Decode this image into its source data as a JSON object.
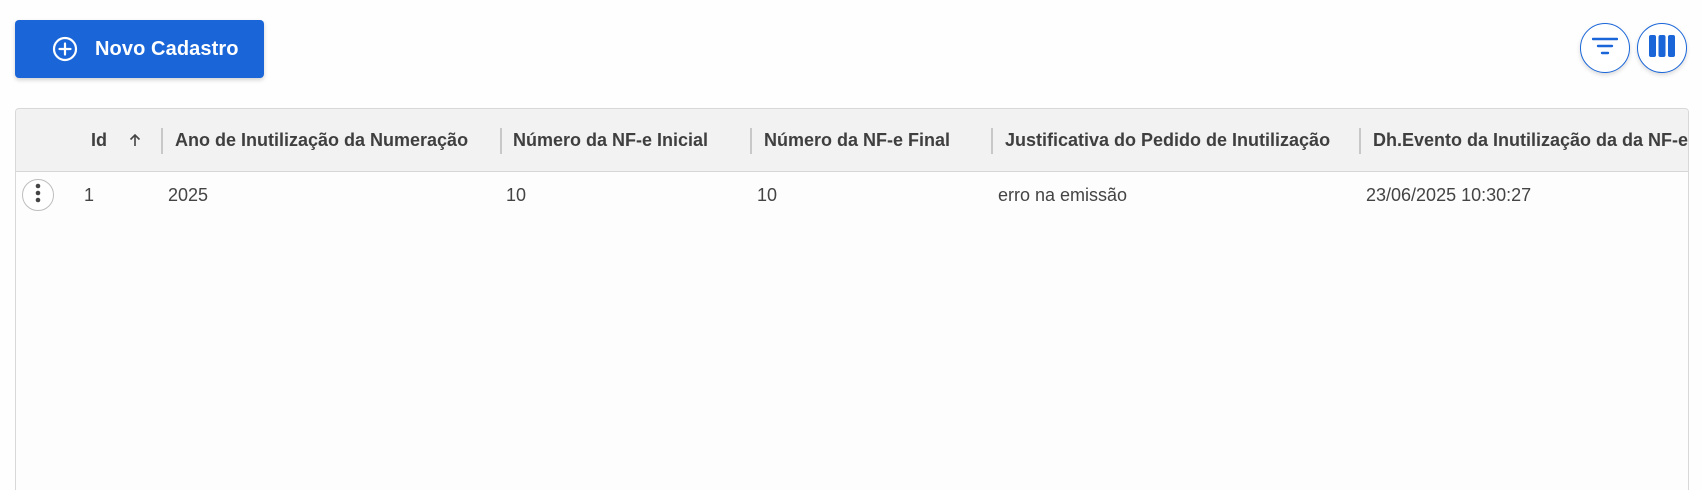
{
  "toolbar": {
    "new_button_label": "Novo Cadastro",
    "new_button_icon": "add-circle-icon",
    "filter_icon": "filter-icon",
    "columns_icon": "columns-icon",
    "accent_color": "#1a66d9"
  },
  "grid": {
    "columns": [
      {
        "key": "id",
        "label": "Id",
        "sort": "ascending"
      },
      {
        "key": "ano",
        "label": "Ano de Inutilização da Numeração"
      },
      {
        "key": "nf_inicial",
        "label": "Número da NF-e Inicial"
      },
      {
        "key": "nf_final",
        "label": "Número da NF-e Final"
      },
      {
        "key": "justificativa",
        "label": "Justificativa do Pedido de Inutilização"
      },
      {
        "key": "dh_evento",
        "label": "Dh.Evento da Inutilização da da NF-e"
      }
    ],
    "rows": [
      {
        "id": "1",
        "ano": "2025",
        "nf_inicial": "10",
        "nf_final": "10",
        "justificativa": "erro na emissão",
        "dh_evento": "23/06/2025 10:30:27",
        "menu_icon": "more-vertical-icon"
      }
    ]
  }
}
